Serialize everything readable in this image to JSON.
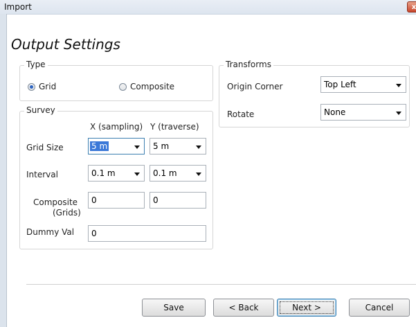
{
  "window": {
    "title": "Import",
    "close_glyph": "x"
  },
  "heading": "Output Settings",
  "type_group": {
    "legend": "Type",
    "options": [
      {
        "label": "Grid",
        "selected": true
      },
      {
        "label": "Composite",
        "selected": false
      }
    ]
  },
  "survey_group": {
    "legend": "Survey",
    "col_x": "X (sampling)",
    "col_y": "Y (traverse)",
    "rows": {
      "grid_size": {
        "label": "Grid Size",
        "x": "5 m",
        "y": "5 m"
      },
      "interval": {
        "label": "Interval",
        "x": "0.1 m",
        "y": "0.1 m"
      },
      "composite": {
        "label_line1": "Composite",
        "label_line2": "(Grids)",
        "x": "0",
        "y": "0"
      },
      "dummy": {
        "label": "Dummy Val",
        "value": "0"
      }
    }
  },
  "transforms_group": {
    "legend": "Transforms",
    "origin_corner": {
      "label": "Origin Corner",
      "value": "Top Left"
    },
    "rotate": {
      "label": "Rotate",
      "value": "None"
    }
  },
  "buttons": {
    "save": "Save",
    "back": "< Back",
    "next": "Next >",
    "cancel": "Cancel"
  },
  "colors": {
    "accent": "#3b78d8",
    "close": "#c9462c"
  }
}
